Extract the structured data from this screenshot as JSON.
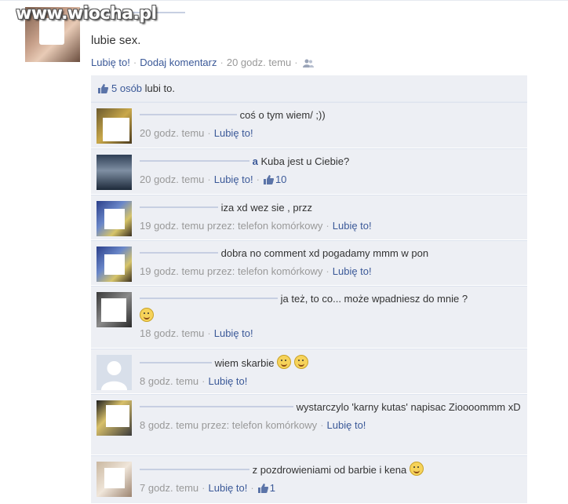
{
  "watermark": "www.wiocha.pl",
  "status": {
    "text": "lubie sex.",
    "actions": {
      "like": "Lubię to!",
      "comment": "Dodaj komentarz",
      "time": "20 godz. temu"
    }
  },
  "likes_summary": {
    "count_link": "5 osób",
    "suffix": "lubi to."
  },
  "comments": [
    {
      "text": "coś o tym wiem/ ;))",
      "time": "20 godz. temu",
      "like": "Lubię to!",
      "via": "",
      "likes": ""
    },
    {
      "text": "Kuba jest u Ciebie?",
      "time": "20 godz. temu",
      "like": "Lubię to!",
      "via": "",
      "likes": "10"
    },
    {
      "text": "iza xd wez sie , przz",
      "time": "19 godz. temu",
      "like": "Lubię to!",
      "via": "przez: telefon komórkowy",
      "likes": ""
    },
    {
      "text": "dobra no comment xd pogadamy mmm w pon",
      "time": "19 godz. temu",
      "like": "Lubię to!",
      "via": "przez: telefon komórkowy",
      "likes": ""
    },
    {
      "text": "ja też, to co... może wpadniesz do mnie ?",
      "time": "18 godz. temu",
      "like": "Lubię to!",
      "via": "",
      "likes": ""
    },
    {
      "text": "wiem skarbie",
      "time": "8 godz. temu",
      "like": "Lubię to!",
      "via": "",
      "likes": ""
    },
    {
      "text": "wystarczylo 'karny kutas' napisac Zioooommm xD",
      "time": "8 godz. temu",
      "like": "Lubię to!",
      "via": "przez: telefon komórkowy",
      "likes": ""
    },
    {
      "text": "z pozdrowieniami od barbie i kena",
      "time": "7 godz. temu",
      "like": "Lubię to!",
      "via": "",
      "likes": "1"
    }
  ],
  "colors": {
    "link": "#3b5998",
    "meta": "#999999",
    "comment_bg": "#edeff4"
  }
}
